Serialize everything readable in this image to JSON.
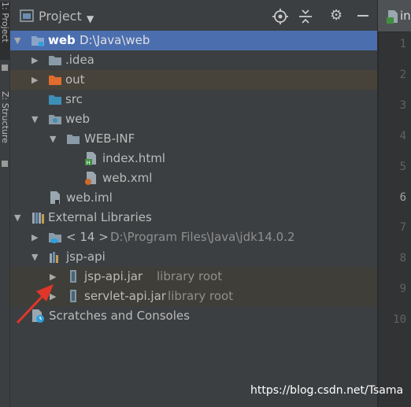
{
  "side_tabs": [
    {
      "label": "1: Project"
    },
    {
      "label": "Z: Structure"
    }
  ],
  "panel": {
    "title": "Project",
    "toolbar_icons": [
      "locate-icon",
      "collapse-icon",
      "gear-icon",
      "minimize-icon"
    ]
  },
  "tree": [
    {
      "label": "web",
      "hint": "D:\\Java\\web"
    },
    {
      "label": ".idea"
    },
    {
      "label": "out"
    },
    {
      "label": "src"
    },
    {
      "label": "web"
    },
    {
      "label": "WEB-INF"
    },
    {
      "label": "index.html"
    },
    {
      "label": "web.xml"
    },
    {
      "label": "web.iml"
    },
    {
      "label": "External Libraries"
    },
    {
      "label": "< 14 >",
      "hint": "D:\\Program Files\\Java\\jdk14.0.2"
    },
    {
      "label": "jsp-api"
    },
    {
      "label": "jsp-api.jar",
      "hint": "library root"
    },
    {
      "label": "servlet-api.jar",
      "hint": "library root"
    },
    {
      "label": "Scratches and Consoles"
    }
  ],
  "editor": {
    "tab_label": "in",
    "line_numbers": [
      "1",
      "2",
      "3",
      "4",
      "5",
      "6",
      "7",
      "8",
      "9",
      "10"
    ],
    "current_line": "6"
  },
  "watermark": "https://blog.csdn.net/Tsama",
  "colors": {
    "selection": "#4b6eaf",
    "excluded_folder": "#e06c2e",
    "source_folder": "#3d8fb8",
    "annotation_arrow": "#e0362a"
  }
}
